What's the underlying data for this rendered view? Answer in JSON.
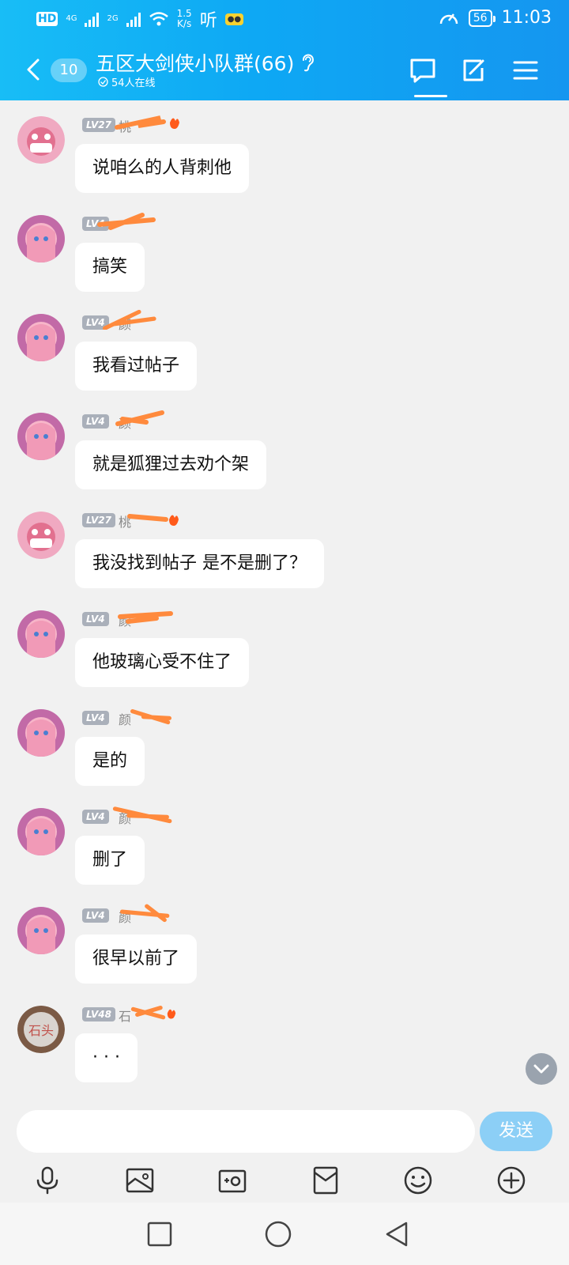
{
  "status": {
    "hd": "HD",
    "net1": "4G",
    "net2": "2G",
    "speed_value": "1.5",
    "speed_unit": "K/s",
    "listen": "听",
    "battery": "56",
    "time": "11:03"
  },
  "header": {
    "unread_count": "10",
    "title": "五区大剑侠小队群(66)",
    "online": "54人在线"
  },
  "messages": [
    {
      "level": "LV27",
      "name_fragment": "桃",
      "text": "说咱么的人背刺他",
      "avatar": "pink-creature"
    },
    {
      "level": "LV4",
      "name_fragment": "",
      "text": "搞笑",
      "avatar": "pink-hair-girl"
    },
    {
      "level": "LV4",
      "name_fragment": "颜",
      "text": "我看过帖子",
      "avatar": "pink-hair-girl"
    },
    {
      "level": "LV4",
      "name_fragment": "颜",
      "text": "就是狐狸过去劝个架",
      "avatar": "pink-hair-girl"
    },
    {
      "level": "LV27",
      "name_fragment": "桃",
      "text": "我没找到帖子 是不是删了？",
      "avatar": "pink-creature"
    },
    {
      "level": "LV4",
      "name_fragment": "颜",
      "text": "他玻璃心受不住了",
      "avatar": "pink-hair-girl"
    },
    {
      "level": "LV4",
      "name_fragment": "颜",
      "text": "是的",
      "avatar": "pink-hair-girl"
    },
    {
      "level": "LV4",
      "name_fragment": "颜",
      "text": "删了",
      "avatar": "pink-hair-girl"
    },
    {
      "level": "LV4",
      "name_fragment": "颜",
      "text": "很早以前了",
      "avatar": "pink-hair-girl"
    },
    {
      "level": "LV48",
      "name_fragment": "石",
      "text": "· · ·",
      "avatar": "stone-logo"
    }
  ],
  "stone_avatar_text": "石头",
  "input": {
    "placeholder": "",
    "value": ""
  },
  "send_label": "发送",
  "colors": {
    "accent": "#12aef4",
    "redaction": "#ff8a3d",
    "send_button": "#8ccff6"
  }
}
